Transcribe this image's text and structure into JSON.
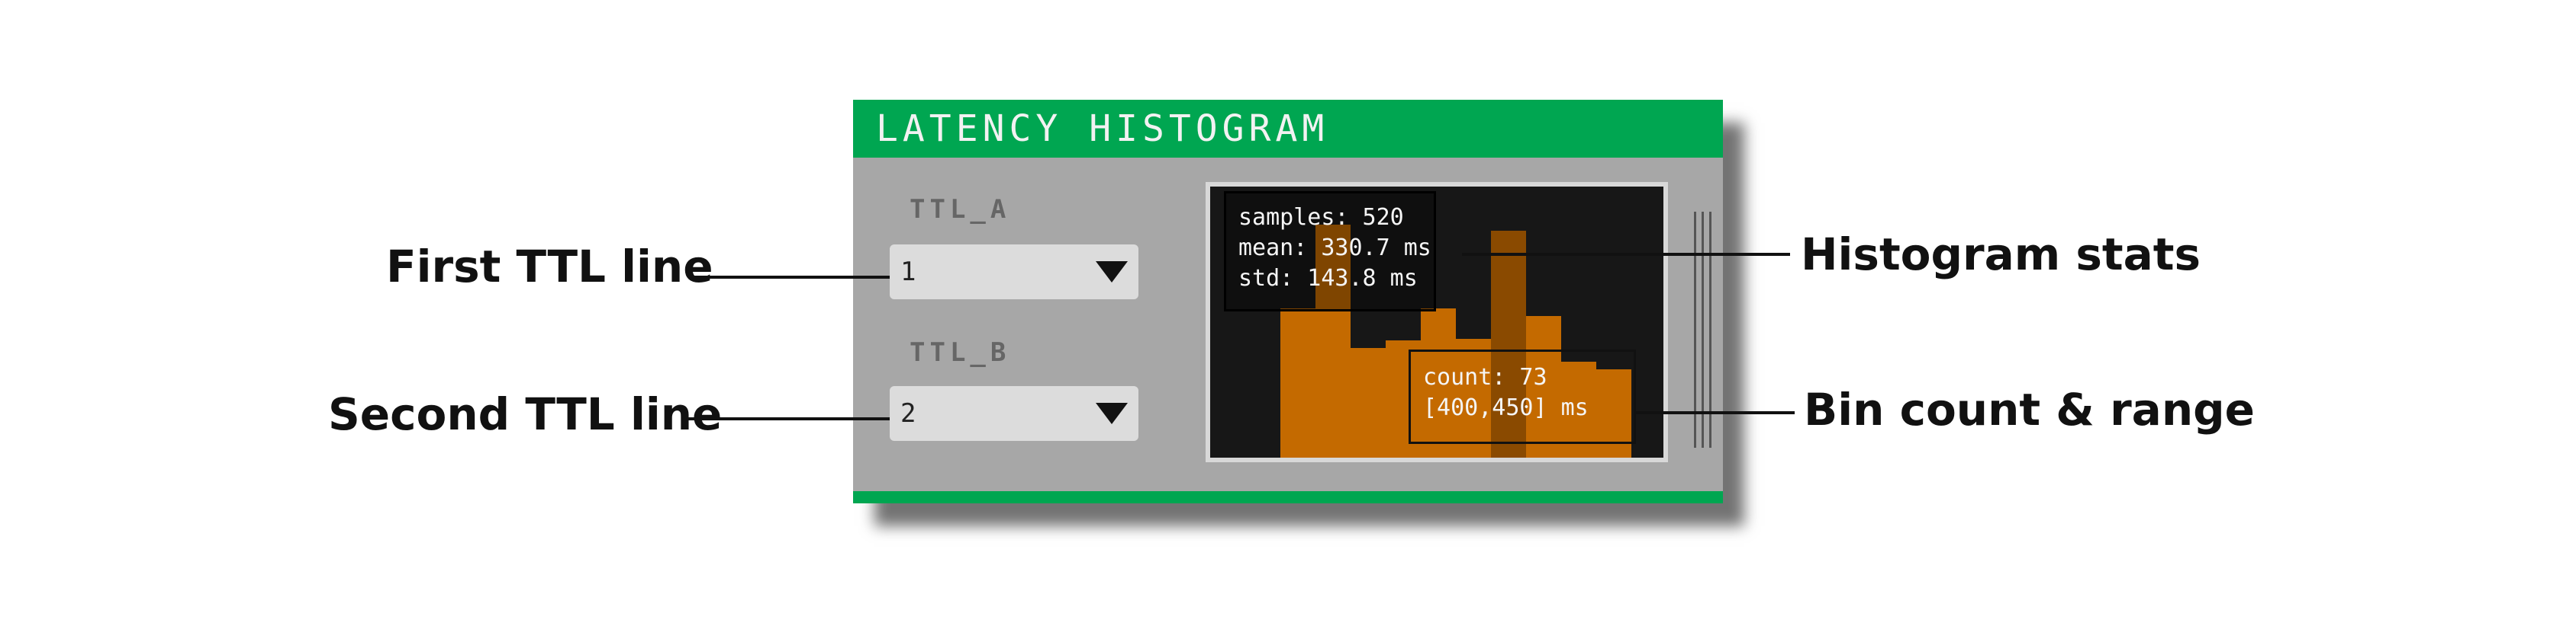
{
  "panel": {
    "title": "LATENCY HISTOGRAM",
    "header_color": "#00a651"
  },
  "controls": {
    "ttl_a": {
      "label": "TTL_A",
      "value": "1"
    },
    "ttl_b": {
      "label": "TTL_B",
      "value": "2"
    }
  },
  "histogram": {
    "stats": {
      "samples": "samples: 520",
      "mean": "mean: 330.7 ms",
      "std": "std: 143.8 ms"
    },
    "hover_bin": {
      "count": "count: 73",
      "range": "[400,450] ms"
    },
    "bar_color": "#c46a00",
    "highlight_color": "#8a4a00"
  },
  "annotations": {
    "first_ttl": "First TTL line",
    "second_ttl": "Second TTL line",
    "histogram_stats": "Histogram stats",
    "bin_count_range": "Bin count & range"
  }
}
